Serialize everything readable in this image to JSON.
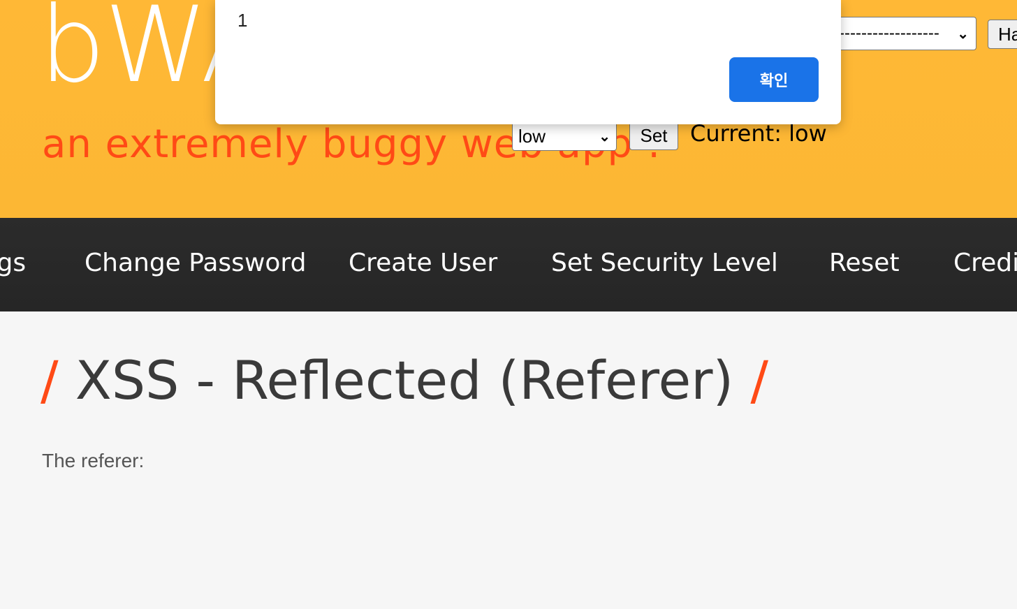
{
  "header": {
    "logo": "bWAPP",
    "tagline": "an extremely buggy web app !",
    "bug_select_value": "------------------",
    "hack_button": "Hack",
    "security": {
      "selected": "low",
      "set_label": "Set",
      "current_label": "Current: low"
    }
  },
  "nav": {
    "items": [
      "Bugs",
      "Change Password",
      "Create User",
      "Set Security Level",
      "Reset",
      "Credits"
    ]
  },
  "main": {
    "title": "XSS - Reflected (Referer)",
    "slash": "/",
    "referer_label": "The referer:"
  },
  "dialog": {
    "message": "1",
    "ok_label": "확인"
  },
  "colors": {
    "header_bg": "#fdb833",
    "accent": "#ff4a16",
    "nav_bg": "#2a2a2a",
    "dialog_button": "#1a73e8"
  }
}
